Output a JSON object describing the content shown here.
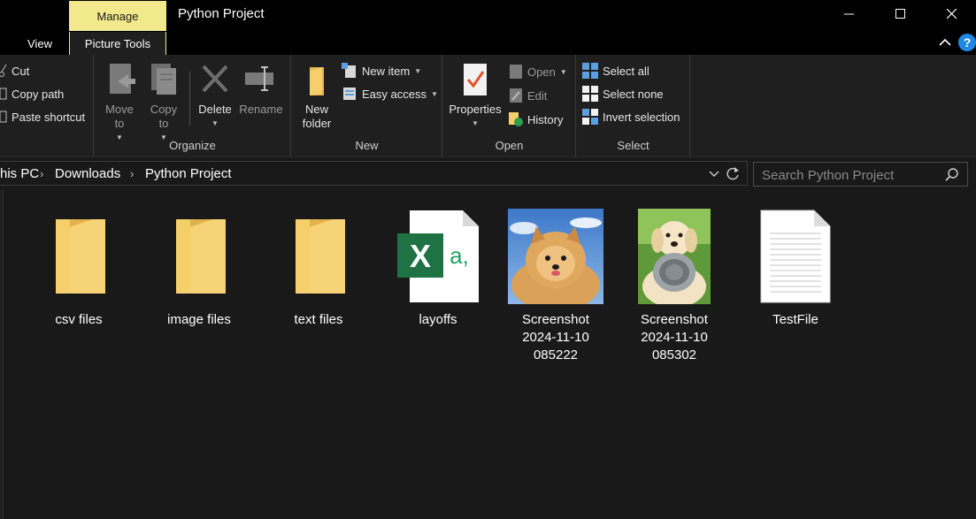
{
  "window": {
    "title": "Python Project",
    "context_tab": "Manage",
    "tabs": [
      "View",
      "Picture Tools"
    ]
  },
  "ribbon": {
    "clipboard": {
      "cut": "Cut",
      "copy_path": "Copy path",
      "paste_shortcut": "Paste shortcut"
    },
    "organize": {
      "label": "Organize",
      "move_to": "Move\nto",
      "copy_to": "Copy\nto",
      "delete": "Delete",
      "rename": "Rename"
    },
    "new": {
      "label": "New",
      "new_folder": "New\nfolder",
      "new_item": "New item",
      "easy_access": "Easy access"
    },
    "open": {
      "label": "Open",
      "properties": "Properties",
      "open": "Open",
      "edit": "Edit",
      "history": "History"
    },
    "select": {
      "label": "Select",
      "select_all": "Select all",
      "select_none": "Select none",
      "invert_selection": "Invert selection"
    }
  },
  "address": {
    "crumbs": [
      "his PC",
      "Downloads",
      "Python Project"
    ]
  },
  "search": {
    "placeholder": "Search Python Project"
  },
  "files": [
    {
      "name": "csv files",
      "type": "folder-icon"
    },
    {
      "name": "image files",
      "type": "folder-icon"
    },
    {
      "name": "text files",
      "type": "folder-icon"
    },
    {
      "name": "layoffs",
      "type": "excel-csv-icon"
    },
    {
      "name": "Screenshot\n2024-11-10\n085222",
      "type": "image-thumbnail"
    },
    {
      "name": "Screenshot\n2024-11-10\n085302",
      "type": "image-thumbnail"
    },
    {
      "name": "TestFile",
      "type": "text-document-icon"
    }
  ],
  "colors": {
    "manage_tab": "#f2e98c",
    "folder": "#f5cf6a",
    "excel_green": "#1f7244",
    "help_blue": "#1e88e5"
  }
}
